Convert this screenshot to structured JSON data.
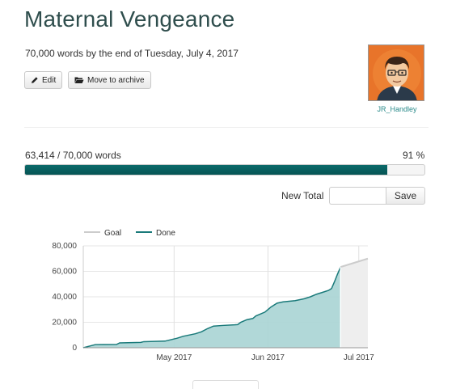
{
  "project": {
    "title": "Maternal Vengeance",
    "subtitle": "70,000 words by the end of Tuesday, July 4, 2017"
  },
  "buttons": {
    "edit": "Edit",
    "archive": "Move to archive",
    "save": "Save"
  },
  "user": {
    "name": "JR_Handley"
  },
  "progress": {
    "label": "63,414 / 70,000 words",
    "percent_label": "91 %",
    "fraction": 0.906
  },
  "new_total": {
    "label": "New Total",
    "value": ""
  },
  "chart_data": {
    "type": "area",
    "legend": [
      "Goal",
      "Done"
    ],
    "legend_position": "top-left",
    "grid": true,
    "ylim": [
      0,
      80000
    ],
    "yticks": [
      "80,000",
      "60,000",
      "40,000",
      "20,000",
      "0"
    ],
    "yvals": [
      80000,
      60000,
      40000,
      20000,
      0
    ],
    "xticks": [
      {
        "label": "May 2017",
        "day": 30
      },
      {
        "label": "Jun 2017",
        "day": 61
      },
      {
        "label": "Jul 2017",
        "day": 91
      }
    ],
    "xrange_days": [
      0,
      94
    ],
    "goal": {
      "name": "Goal",
      "color": "#cccccc",
      "points": [
        [
          85,
          63414
        ],
        [
          94,
          70000
        ]
      ]
    },
    "done": {
      "name": "Done",
      "color": "#1a7a7a",
      "fill": "#a8d4d4",
      "points": [
        [
          0,
          0
        ],
        [
          4,
          2500
        ],
        [
          11,
          2600
        ],
        [
          12,
          3800
        ],
        [
          19,
          4200
        ],
        [
          20,
          4800
        ],
        [
          27,
          5200
        ],
        [
          31,
          7500
        ],
        [
          33,
          9000
        ],
        [
          37,
          11000
        ],
        [
          39,
          12500
        ],
        [
          41,
          15000
        ],
        [
          43,
          17000
        ],
        [
          46,
          17500
        ],
        [
          50,
          18000
        ],
        [
          51,
          18200
        ],
        [
          52,
          20000
        ],
        [
          54,
          22000
        ],
        [
          56,
          23000
        ],
        [
          57,
          25000
        ],
        [
          60,
          28000
        ],
        [
          62,
          32000
        ],
        [
          64,
          35000
        ],
        [
          66,
          36000
        ],
        [
          70,
          37000
        ],
        [
          73,
          38500
        ],
        [
          75,
          40000
        ],
        [
          77,
          42000
        ],
        [
          79,
          43500
        ],
        [
          81,
          45000
        ],
        [
          82,
          46500
        ],
        [
          83,
          52000
        ],
        [
          84,
          58000
        ],
        [
          85,
          63414
        ]
      ]
    }
  }
}
